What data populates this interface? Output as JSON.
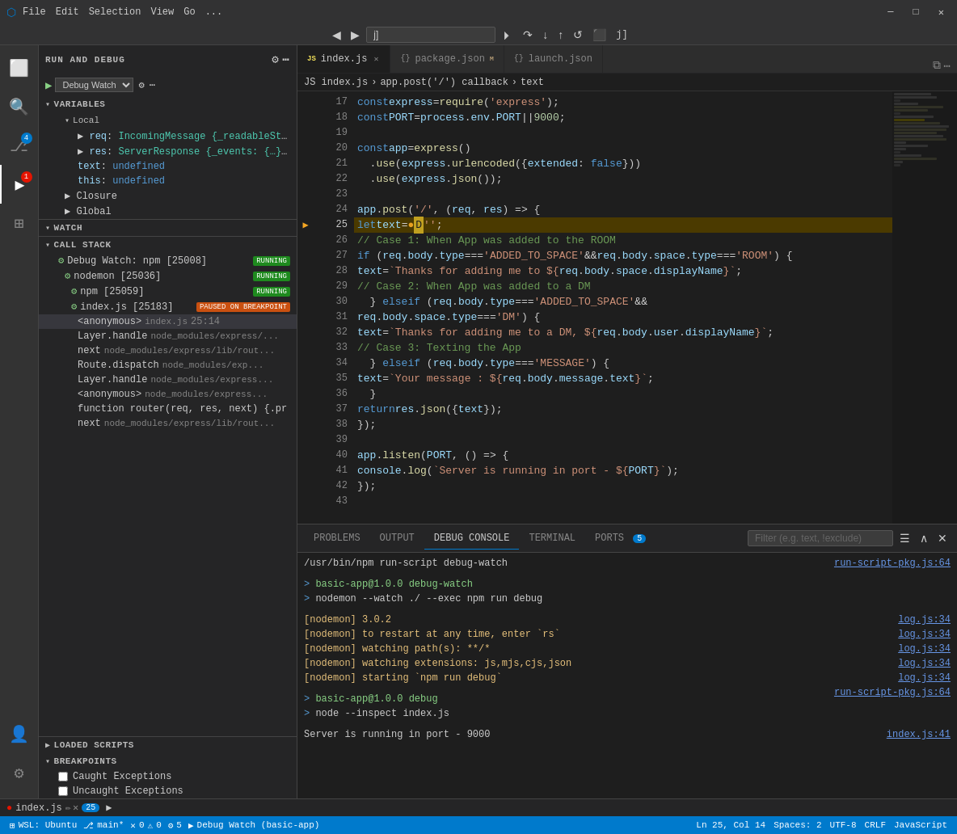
{
  "titlebar": {
    "menu_items": [
      "File",
      "Edit",
      "Selection",
      "View",
      "Go",
      "..."
    ],
    "window_controls": [
      "minimize",
      "maximize",
      "close"
    ]
  },
  "debug_toolbar": {
    "input_value": "j]",
    "buttons": [
      "continue",
      "step-over",
      "step-into",
      "step-out",
      "restart",
      "stop"
    ]
  },
  "activity_bar": {
    "items": [
      {
        "name": "explorer",
        "icon": "⬜",
        "active": false
      },
      {
        "name": "search",
        "icon": "🔍",
        "active": false
      },
      {
        "name": "source-control",
        "icon": "⎇",
        "badge": "4"
      },
      {
        "name": "run-debug",
        "icon": "▶",
        "active": true,
        "badge": "1"
      },
      {
        "name": "extensions",
        "icon": "⊞"
      },
      {
        "name": "accounts",
        "icon": "👤"
      },
      {
        "name": "settings",
        "icon": "⚙"
      }
    ]
  },
  "sidebar": {
    "title": "RUN AND DEBUG",
    "debug_select": "Debug Watch",
    "variables": {
      "header": "VARIABLES",
      "sections": [
        {
          "name": "Local",
          "items": [
            {
              "key": "req",
              "value": "IncomingMessage {_readableState: ..."
            },
            {
              "key": "res",
              "value": "ServerResponse {_events: {…}, _ev..."
            },
            {
              "key": "text",
              "value": "undefined"
            },
            {
              "key": "this",
              "value": "undefined"
            }
          ]
        },
        {
          "name": "Closure"
        },
        {
          "name": "Global"
        }
      ]
    },
    "watch": {
      "header": "WATCH"
    },
    "call_stack": {
      "header": "CALL STACK",
      "frames": [
        {
          "name": "Debug Watch: npm [25008]",
          "status": "RUNNING",
          "indent": 1
        },
        {
          "name": "nodemon [25036]",
          "status": "RUNNING",
          "indent": 2
        },
        {
          "name": "npm [25059]",
          "status": "RUNNING",
          "indent": 3
        },
        {
          "name": "index.js [25183]",
          "status": "PAUSED ON BREAKPOINT",
          "indent": 3
        },
        {
          "name": "<anonymous>",
          "file": "index.js",
          "line": "25:14",
          "indent": 4
        },
        {
          "name": "Layer.handle",
          "file": "node_modules/express/...",
          "indent": 4
        },
        {
          "name": "next",
          "file": "node_modules/express/lib/rout...",
          "indent": 4
        },
        {
          "name": "Route.dispatch",
          "file": "node_modules/exp...",
          "indent": 4
        },
        {
          "name": "Layer.handle",
          "file": "node_modules/express...",
          "indent": 4
        },
        {
          "name": "<anonymous>",
          "file": "node_modules/express...",
          "indent": 4
        },
        {
          "name": "function router(req, res, next) {.pr",
          "indent": 4
        },
        {
          "name": "next",
          "file": "node_modules/express/lib/rout...",
          "indent": 4
        }
      ]
    },
    "loaded_scripts": {
      "header": "LOADED SCRIPTS"
    },
    "breakpoints": {
      "header": "BREAKPOINTS",
      "items": [
        {
          "label": "Caught Exceptions",
          "checked": false
        },
        {
          "label": "Uncaught Exceptions",
          "checked": false
        }
      ]
    }
  },
  "editor": {
    "tabs": [
      {
        "name": "index.js",
        "active": true,
        "modified": false,
        "icon": "JS"
      },
      {
        "name": "package.json",
        "active": false,
        "modified": true,
        "icon": "{}"
      },
      {
        "name": "launch.json",
        "active": false,
        "modified": false,
        "icon": "{}"
      }
    ],
    "breadcrumb": [
      "index.js",
      "app.post('/') callback",
      "text"
    ],
    "current_line": 25,
    "lines": [
      {
        "num": 17,
        "content": "const express = require('express');"
      },
      {
        "num": 18,
        "content": "const PORT = process.env.PORT || 9000;"
      },
      {
        "num": 19,
        "content": ""
      },
      {
        "num": 20,
        "content": "const app = express()"
      },
      {
        "num": 21,
        "content": "  .use(express.urlencoded({extended: false}))"
      },
      {
        "num": 22,
        "content": "  .use(express.json());"
      },
      {
        "num": 23,
        "content": ""
      },
      {
        "num": 24,
        "content": "app.post('/', (req, res) => {"
      },
      {
        "num": 25,
        "content": "  let text = ● D'';",
        "debug": true
      },
      {
        "num": 26,
        "content": "  // Case 1: When App was added to the ROOM"
      },
      {
        "num": 27,
        "content": "  if (req.body.type === 'ADDED_TO_SPACE' && req.body.space.type === 'ROOM') {"
      },
      {
        "num": 28,
        "content": "    text = `Thanks for adding me to ${req.body.space.displayName}`;"
      },
      {
        "num": 29,
        "content": "    // Case 2: When App was added to a DM"
      },
      {
        "num": 30,
        "content": "  } else if (req.body.type === 'ADDED_TO_SPACE' &&"
      },
      {
        "num": 31,
        "content": "    req.body.space.type === 'DM') {"
      },
      {
        "num": 32,
        "content": "    text = `Thanks for adding me to a DM, ${req.body.user.displayName}`;"
      },
      {
        "num": 33,
        "content": "    // Case 3: Texting the App"
      },
      {
        "num": 34,
        "content": "  } else if (req.body.type === 'MESSAGE') {"
      },
      {
        "num": 35,
        "content": "    text = `Your message : ${req.body.message.text}`;"
      },
      {
        "num": 36,
        "content": "  }"
      },
      {
        "num": 37,
        "content": "  return res.json({text});"
      },
      {
        "num": 38,
        "content": "});"
      },
      {
        "num": 39,
        "content": ""
      },
      {
        "num": 40,
        "content": "app.listen(PORT, () => {"
      },
      {
        "num": 41,
        "content": "  console.log(`Server is running in port - ${PORT}`);"
      },
      {
        "num": 42,
        "content": "});"
      },
      {
        "num": 43,
        "content": ""
      }
    ]
  },
  "panel": {
    "tabs": [
      {
        "label": "PROBLEMS",
        "active": false
      },
      {
        "label": "OUTPUT",
        "active": false
      },
      {
        "label": "DEBUG CONSOLE",
        "active": true
      },
      {
        "label": "TERMINAL",
        "active": false
      },
      {
        "label": "PORTS",
        "active": false,
        "badge": "5"
      }
    ],
    "filter_placeholder": "Filter (e.g. text, !exclude)",
    "console_lines": [
      {
        "text": "/usr/bin/npm run-script debug-watch",
        "class": "console-output",
        "link": null
      },
      {
        "text": "",
        "link": "run-script-pkg.js:64"
      },
      {
        "text": "> basic-app@1.0.0 debug-watch",
        "class": "console-green"
      },
      {
        "text": "> nodemon --watch ./ --exec npm run debug",
        "class": "console-output"
      },
      {
        "text": ""
      },
      {
        "text": "[nodemon] 3.0.2",
        "class": "console-yellow",
        "link": "log.js:34"
      },
      {
        "text": "[nodemon] to restart at any time, enter `rs`",
        "class": "console-yellow",
        "link": "log.js:34"
      },
      {
        "text": "[nodemon] watching path(s): **/*",
        "class": "console-yellow",
        "link": "log.js:34"
      },
      {
        "text": "[nodemon] watching extensions: js,mjs,cjs,json",
        "class": "console-yellow",
        "link": "log.js:34"
      },
      {
        "text": "[nodemon] starting `npm run debug`",
        "class": "console-yellow",
        "link": "log.js:34"
      },
      {
        "text": "",
        "link": "run-script-pkg.js:64"
      },
      {
        "text": "> basic-app@1.0.0 debug",
        "class": "console-green"
      },
      {
        "text": "> node --inspect index.js",
        "class": "console-output"
      },
      {
        "text": ""
      },
      {
        "text": "Server is running in port - 9000",
        "class": "console-output",
        "link": "index.js:41"
      }
    ]
  },
  "status_bar": {
    "wsl": "WSL: Ubuntu",
    "branch": "main*",
    "errors": "0",
    "warnings": "0",
    "debug_sessions": "5",
    "debug_watch": "Debug Watch (basic-app)",
    "line_col": "Ln 25, Col 14",
    "spaces": "Spaces: 2",
    "encoding": "UTF-8",
    "line_endings": "CRLF",
    "language": "JavaScript"
  },
  "bottom_tab": {
    "icon": "●",
    "label": "index.js",
    "edit_icon": "✏",
    "close_icon": "✕",
    "count": "25",
    "arrow": "▶"
  }
}
